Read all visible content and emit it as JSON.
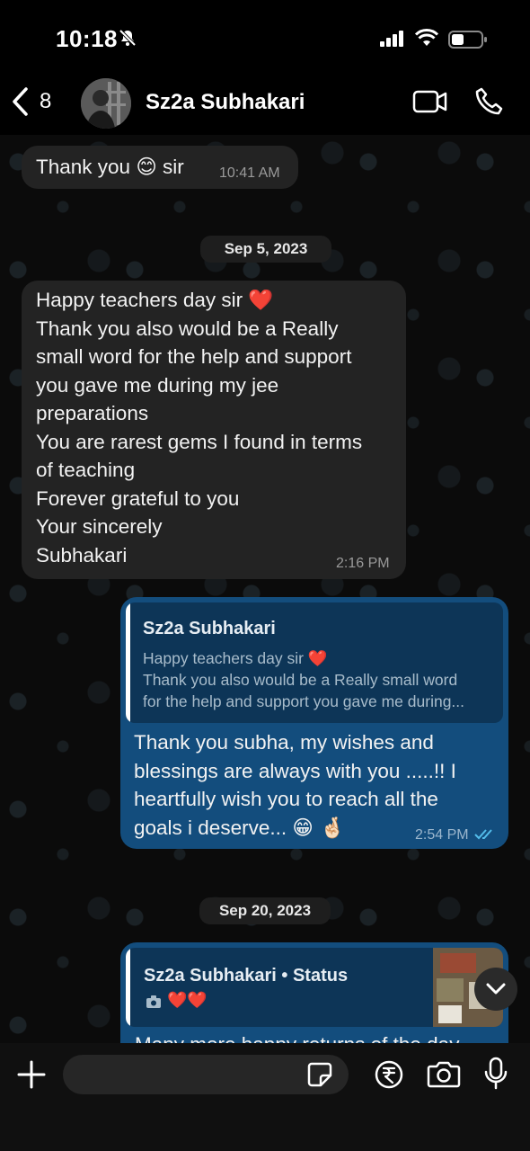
{
  "status_bar": {
    "time": "10:18"
  },
  "header": {
    "back_count": "8",
    "contact_name": "Sz2a Subhakari"
  },
  "messages": [
    {
      "text_parts": [
        "Thank you ",
        "😊",
        " sir"
      ],
      "time": "10:41 AM"
    },
    {
      "date": "Sep 5, 2023"
    },
    {
      "lines": [
        "Happy teachers day sir",
        "Thank you also would be a Really",
        "small word for the help and support",
        "you gave me during my jee",
        "preparations",
        "You are rarest gems I found in terms",
        "of teaching",
        "Forever grateful to you",
        "Your sincerely",
        "Subhakari"
      ],
      "heart": "❤️",
      "time": "2:16 PM"
    },
    {
      "reply": {
        "name": "Sz2a Subhakari",
        "line1": "Happy teachers day sir",
        "line2": "Thank you also would be a Really small word",
        "line3": "for the help and support you gave me during..."
      },
      "lines": [
        "Thank you subha, my wishes and",
        "blessings are always with you .....!! I",
        "heartfully wish you to reach all the",
        "goals i deserve..."
      ],
      "emojis": "😁 🤞🏻",
      "time": "2:54 PM"
    },
    {
      "date": "Sep 20, 2023"
    },
    {
      "reply": {
        "name": "Sz2a Subhakari • Status",
        "hearts": "❤️❤️"
      },
      "partial_text": "Many more happy returns of the day"
    }
  ],
  "icons": {
    "back": "chevron-left-icon",
    "video": "video-camera-icon",
    "call": "phone-icon",
    "attach": "plus-icon",
    "sticker": "sticker-icon",
    "payment": "rupee-icon",
    "camera": "camera-icon",
    "mic": "microphone-icon",
    "scroll": "chevron-down-icon"
  },
  "colors": {
    "incoming": "#232323",
    "outgoing": "#134d7d",
    "read_ticks": "#53bdeb",
    "heart": "#e0202b"
  }
}
